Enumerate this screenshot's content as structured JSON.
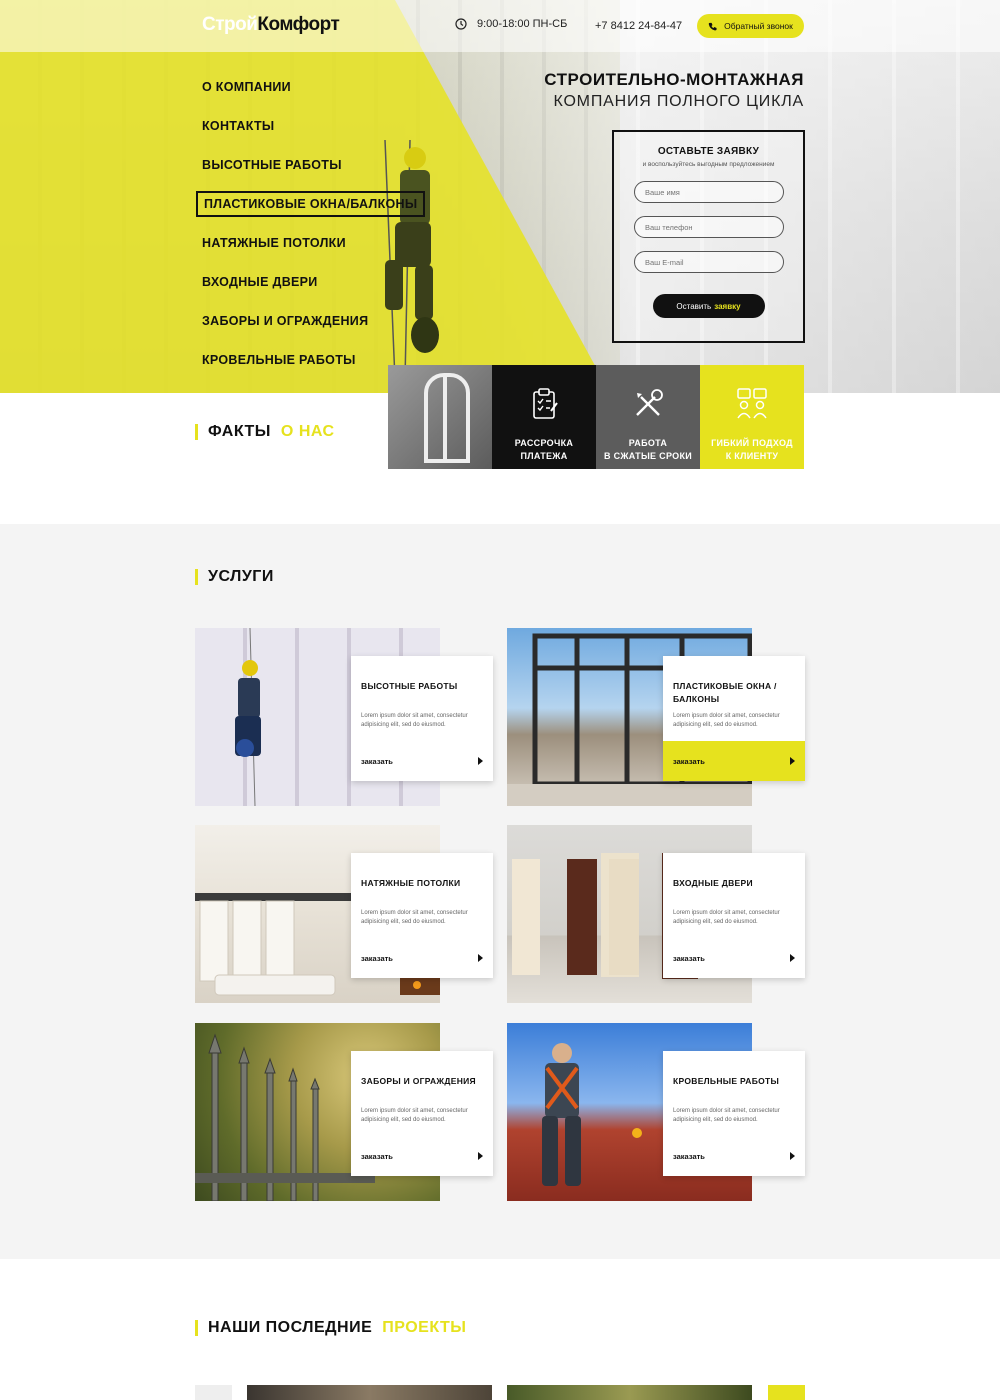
{
  "header": {
    "logo_part1": "Строй",
    "logo_part2": "Комфорт",
    "hours": "9:00-18:00 ПН-СБ",
    "phone": "+7 8412 24-84-47",
    "callback_label": "Обратный звонок"
  },
  "nav": {
    "items": [
      {
        "label": "О КОМПАНИИ"
      },
      {
        "label": "КОНТАКТЫ"
      },
      {
        "label": "ВЫСОТНЫЕ РАБОТЫ"
      },
      {
        "label": "ПЛАСТИКОВЫЕ ОКНА/БАЛКОНЫ"
      },
      {
        "label": "НАТЯЖНЫЕ ПОТОЛКИ"
      },
      {
        "label": "ВХОДНЫЕ ДВЕРИ"
      },
      {
        "label": "ЗАБОРЫ И ОГРАЖДЕНИЯ"
      },
      {
        "label": "КРОВЕЛЬНЫЕ РАБОТЫ"
      }
    ],
    "active_index": 3
  },
  "hero": {
    "title_line1": "СТРОИТЕЛЬНО-МОНТАЖНАЯ",
    "title_line2": "КОМПАНИЯ ПОЛНОГО ЦИКЛА"
  },
  "form": {
    "title": "ОСТАВЬТЕ ЗАЯВКУ",
    "subtitle": "и воспользуйтесь выгодным предложением",
    "name_placeholder": "Ваше имя",
    "phone_placeholder": "Ваш телефон",
    "email_placeholder": "Ваш E-mail",
    "submit_part1": "Оставить",
    "submit_part2": "заявку"
  },
  "facts": {
    "title_part1": "ФАКТЫ",
    "title_part2": "О НАС",
    "tiles": [
      {
        "label": "РАССРОЧКА\nПЛАТЕЖА",
        "icon": "clipboard-icon"
      },
      {
        "label": "РАБОТА\nВ СЖАТЫЕ СРОКИ",
        "icon": "tools-icon"
      },
      {
        "label": "ГИБКИЙ ПОДХОД\nК КЛИЕНТУ",
        "icon": "people-chat-icon"
      }
    ]
  },
  "services": {
    "title": "УСЛУГИ",
    "order_label": "заказать",
    "lorem": "Lorem ipsum dolor sit amet, consectetur adipisicing elit, sed do eiusmod.",
    "items": [
      {
        "title": "ВЫСОТНЫЕ РАБОТЫ"
      },
      {
        "title": "ПЛАСТИКОВЫЕ ОКНА / БАЛКОНЫ"
      },
      {
        "title": "НАТЯЖНЫЕ ПОТОЛКИ"
      },
      {
        "title": "ВХОДНЫЕ ДВЕРИ"
      },
      {
        "title": "ЗАБОРЫ И ОГРАЖДЕНИЯ"
      },
      {
        "title": "КРОВЕЛЬНЫЕ РАБОТЫ"
      }
    ]
  },
  "projects": {
    "title_part1": "НАШИ ПОСЛЕДНИЕ",
    "title_part2": "ПРОЕКТЫ"
  },
  "colors": {
    "accent": "#e6e21e",
    "dark": "#111111",
    "gray": "#5c5c5c"
  }
}
